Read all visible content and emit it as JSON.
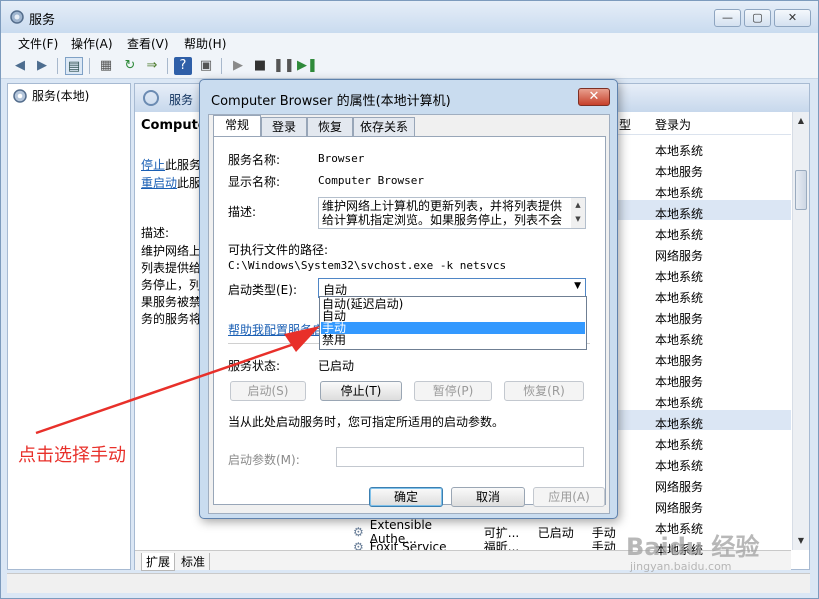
{
  "window": {
    "title": "服务",
    "buttons": {
      "minimize": "—",
      "maximize": "▢",
      "close": "✕"
    }
  },
  "menu": [
    "文件(F)",
    "操作(A)",
    "查看(V)",
    "帮助(H)"
  ],
  "tree": {
    "item": "服务(本地)"
  },
  "pane": {
    "header": "服务",
    "service_title": "Computer",
    "link_stop": "停止",
    "link_stop_rest": "此服务",
    "link_restart": "重启动",
    "link_restart_rest": "此服",
    "desc_label": "描述:",
    "desc_lines": [
      "维护网络上",
      "列表提供给",
      "务停止，列",
      "果服务被禁",
      "务的服务将"
    ],
    "col_type": "型",
    "col_logon": "登录为",
    "logon_values": [
      "本地系统",
      "本地服务",
      "本地系统",
      "本地系统",
      "本地系统",
      "网络服务",
      "本地系统",
      "本地系统",
      "本地服务",
      "本地系统",
      "本地服务",
      "本地服务",
      "本地系统",
      "本地系统",
      "本地系统",
      "本地系统",
      "网络服务",
      "网络服务",
      "本地系统",
      "本地系统"
    ],
    "bottom_rows": [
      {
        "name": "Extensible Authe...",
        "desc": "可扩...",
        "status": "已启动",
        "type": "手动",
        "logon": "本地系统"
      },
      {
        "name": "Foxit Service",
        "desc": "福昕...",
        "status": "",
        "type": "手动",
        "logon": "本地系统"
      }
    ],
    "tabs": [
      "扩展",
      "标准"
    ]
  },
  "dialog": {
    "title": "Computer Browser 的属性(本地计算机)",
    "close": "✕",
    "tabs": [
      "常规",
      "登录",
      "恢复",
      "依存关系"
    ],
    "service_name_label": "服务名称:",
    "service_name": "Browser",
    "display_name_label": "显示名称:",
    "display_name": "Computer Browser",
    "desc_label": "描述:",
    "desc_text": "维护网络上计算机的更新列表，并将列表提供给计算机指定浏览。如果服务停止，列表不会",
    "path_label": "可执行文件的路径:",
    "path": "C:\\Windows\\System32\\svchost.exe -k netsvcs",
    "startup_label": "启动类型(E):",
    "startup_value": "自动",
    "startup_options": [
      "自动(延迟启动)",
      "自动",
      "手动",
      "禁用"
    ],
    "help_link": "帮助我配置服务启",
    "status_label": "服务状态:",
    "status_value": "已启动",
    "btn_start": "启动(S)",
    "btn_stop": "停止(T)",
    "btn_pause": "暂停(P)",
    "btn_resume": "恢复(R)",
    "hint": "当从此处启动服务时，您可指定所适用的启动参数。",
    "param_label": "启动参数(M):",
    "ok": "确定",
    "cancel": "取消",
    "apply": "应用(A)"
  },
  "annotation": {
    "text": "点击选择手动",
    "color": "#e8302a"
  },
  "watermark": {
    "main": "Baidu 经验",
    "sub": "jingyan.baidu.com"
  }
}
